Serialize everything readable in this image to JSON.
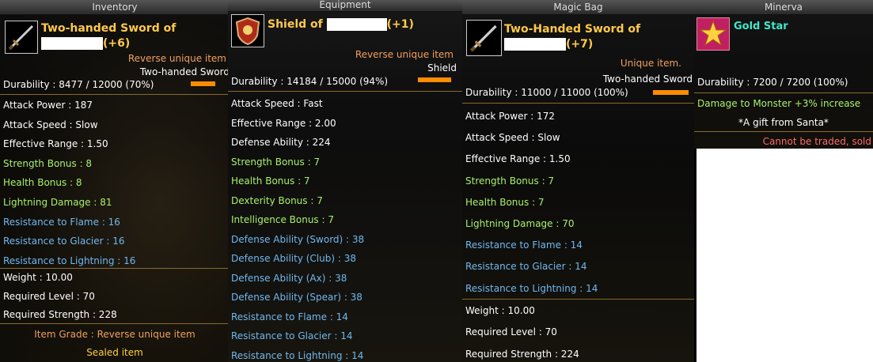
{
  "inventory": {
    "title": "Inventory",
    "name_line1": "Two-handed Sword of",
    "name_suffix": "(+6)",
    "rarity": "Reverse unique item",
    "item_type": "Two-handed Sword",
    "durability": "Durability : 8477 / 12000 (70%)",
    "durability_fraction": 0.7,
    "stats": [
      {
        "text": "Attack Power : 187",
        "color": "#ffffff"
      },
      {
        "text": "Attack Speed : Slow",
        "color": "#ffffff"
      },
      {
        "text": "Effective Range : 1.50",
        "color": "#ffffff"
      },
      {
        "text": "Strength Bonus : 8",
        "color": "#a8f06a"
      },
      {
        "text": "Health Bonus : 8",
        "color": "#a8f06a"
      },
      {
        "text": "Lightning Damage : 81",
        "color": "#a8f06a"
      },
      {
        "text": "Resistance to Flame : 16",
        "color": "#6fb8f0"
      },
      {
        "text": "Resistance to Glacier : 16",
        "color": "#6fb8f0"
      },
      {
        "text": "Resistance to Lightning : 16",
        "color": "#6fb8f0"
      }
    ],
    "weight": "Weight : 10.00",
    "required_level": "Required Level : 70",
    "required_strength": "Required Strength : 228",
    "grade": "Item Grade : Reverse unique item",
    "sealed": "Sealed item"
  },
  "equipment": {
    "title": "Equipment",
    "name_line1": "Shield of",
    "name_suffix": "(+1)",
    "rarity": "Reverse unique item",
    "item_type": "Shield",
    "durability": "Durability : 14184 / 15000 (94%)",
    "durability_fraction": 0.94,
    "stats": [
      {
        "text": "Attack Speed : Fast",
        "color": "#ffffff"
      },
      {
        "text": "Effective Range : 2.00",
        "color": "#ffffff"
      },
      {
        "text": "Defense Ability : 224",
        "color": "#ffffff"
      },
      {
        "text": "Strength Bonus : 7",
        "color": "#a8f06a"
      },
      {
        "text": "Health Bonus : 7",
        "color": "#a8f06a"
      },
      {
        "text": "Dexterity Bonus : 7",
        "color": "#a8f06a"
      },
      {
        "text": "Intelligence Bonus : 7",
        "color": "#a8f06a"
      },
      {
        "text": "Defense Ability (Sword) : 38",
        "color": "#6fb8f0"
      },
      {
        "text": "Defense Ability (Club) : 38",
        "color": "#6fb8f0"
      },
      {
        "text": "Defense Ability (Ax) : 38",
        "color": "#6fb8f0"
      },
      {
        "text": "Defense Ability (Spear) : 38",
        "color": "#6fb8f0"
      },
      {
        "text": "Resistance to Flame : 14",
        "color": "#6fb8f0"
      },
      {
        "text": "Resistance to Glacier : 14",
        "color": "#6fb8f0"
      },
      {
        "text": "Resistance to Lightning : 14",
        "color": "#6fb8f0"
      }
    ]
  },
  "magic_bag": {
    "title": "Magic Bag",
    "name_line1": "Two-Handed Sword of",
    "name_suffix": "(+7)",
    "rarity": "Unique item.",
    "item_type": "Two-handed Sword",
    "durability": "Durability : 11000 / 11000 (100%)",
    "durability_fraction": 1.0,
    "stats": [
      {
        "text": "Attack Power : 172",
        "color": "#ffffff"
      },
      {
        "text": "Attack Speed : Slow",
        "color": "#ffffff"
      },
      {
        "text": "Effective Range : 1.50",
        "color": "#ffffff"
      },
      {
        "text": "Strength Bonus : 7",
        "color": "#a8f06a"
      },
      {
        "text": "Health Bonus : 7",
        "color": "#a8f06a"
      },
      {
        "text": "Lightning Damage : 70",
        "color": "#a8f06a"
      },
      {
        "text": "Resistance to Flame : 14",
        "color": "#6fb8f0"
      },
      {
        "text": "Resistance to Glacier : 14",
        "color": "#6fb8f0"
      },
      {
        "text": "Resistance to Lightning : 14",
        "color": "#6fb8f0"
      }
    ],
    "weight": "Weight : 10.00",
    "required_level": "Required Level : 70",
    "required_strength": "Required Strength : 224"
  },
  "minerva": {
    "title": "Minerva",
    "name": "Gold Star",
    "durability": "Durability : 7200 / 7200 (100%)",
    "bonus": "Damage to Monster +3% increase",
    "gift": "*A gift from Santa*",
    "restriction": "Cannot be traded, sold"
  },
  "colors": {
    "name": "#ffc94a",
    "rarity": "#f0a060",
    "bonus_green": "#a8f06a",
    "resist_blue": "#6fb8f0",
    "grade_orange": "#f0a060",
    "sealed_yellow": "#ffd040",
    "restriction_red": "#ff6a6a",
    "durability_bar": "#ff8c00",
    "gold_star_name": "#40e8c8"
  },
  "icons": [
    "sword-icon",
    "shield-icon",
    "sword-icon",
    "gold-star-icon"
  ]
}
